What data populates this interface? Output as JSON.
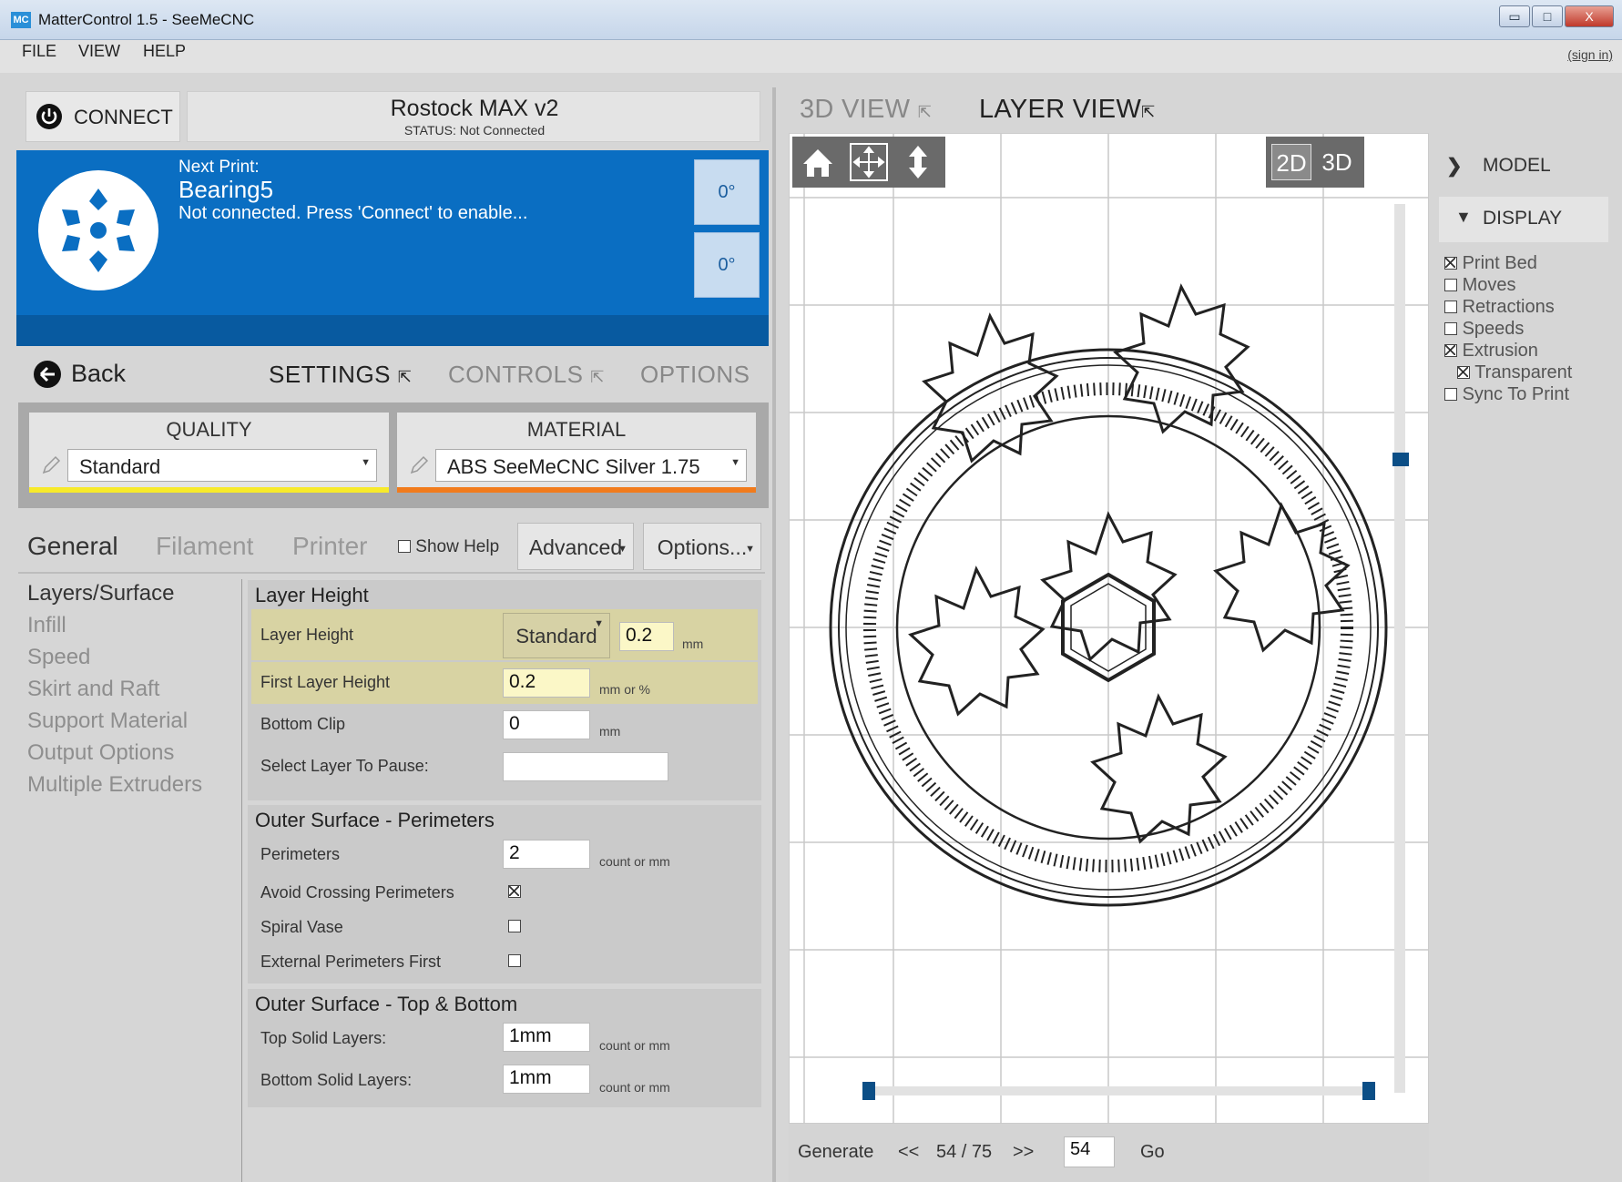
{
  "window": {
    "title": "MatterControl 1.5 - SeeMeCNC",
    "icon_label": "MC",
    "min": "▭",
    "max": "□",
    "close": "X"
  },
  "menu": {
    "items": [
      "FILE",
      "VIEW",
      "HELP"
    ],
    "sign_in": "(sign in)"
  },
  "printer": {
    "connect_label": "CONNECT",
    "name": "Rostock MAX v2",
    "status": "STATUS: Not Connected"
  },
  "print_panel": {
    "next_print_label": "Next Print:",
    "part_name": "Bearing5",
    "message": "Not connected. Press 'Connect' to enable...",
    "extruder_temp": "0°",
    "bed_temp": "0°"
  },
  "nav": {
    "back_label": "Back",
    "tabs": [
      {
        "label": "SETTINGS",
        "active": true
      },
      {
        "label": "CONTROLS",
        "active": false
      },
      {
        "label": "OPTIONS",
        "active": false
      }
    ]
  },
  "quality": {
    "title": "QUALITY",
    "value": "Standard",
    "color": "#f7ea2a"
  },
  "material": {
    "title": "MATERIAL",
    "value": "ABS SeeMeCNC Silver 1.75",
    "color": "#f17b1c"
  },
  "settings_tabs": {
    "tabs": [
      "General",
      "Filament",
      "Printer"
    ],
    "show_help": "Show Help",
    "advanced": "Advanced",
    "options": "Options..."
  },
  "categories": [
    "Layers/Surface",
    "Infill",
    "Speed",
    "Skirt and Raft",
    "Support Material",
    "Output Options",
    "Multiple Extruders"
  ],
  "groups": {
    "layer_height": {
      "title": "Layer Height",
      "layer_height": {
        "label": "Layer Height",
        "preset": "Standard",
        "value": "0.2",
        "unit": "mm"
      },
      "first_layer_height": {
        "label": "First Layer Height",
        "value": "0.2",
        "unit": "mm or %"
      },
      "bottom_clip": {
        "label": "Bottom Clip",
        "value": "0",
        "unit": "mm"
      },
      "pause_layer": {
        "label": "Select Layer To Pause:",
        "value": ""
      }
    },
    "perimeters": {
      "title": "Outer Surface - Perimeters",
      "perimeters": {
        "label": "Perimeters",
        "value": "2",
        "unit": "count or mm"
      },
      "avoid_crossing": {
        "label": "Avoid Crossing Perimeters",
        "checked": true
      },
      "spiral_vase": {
        "label": "Spiral Vase",
        "checked": false
      },
      "external_first": {
        "label": "External Perimeters First",
        "checked": false
      }
    },
    "top_bottom": {
      "title": "Outer Surface - Top & Bottom",
      "top_solid": {
        "label": "Top Solid Layers:",
        "value": "1mm",
        "unit": "count or mm"
      },
      "bottom_solid": {
        "label": "Bottom Solid Layers:",
        "value": "1mm",
        "unit": "count or mm"
      }
    }
  },
  "view_tabs": [
    {
      "label": "3D VIEW",
      "active": false
    },
    {
      "label": "LAYER VIEW",
      "active": true
    }
  ],
  "view_mode": {
    "d2": "2D",
    "d3": "3D"
  },
  "side_panel": {
    "model": "MODEL",
    "display": "DISPLAY",
    "options": [
      {
        "label": "Print Bed",
        "checked": true
      },
      {
        "label": "Moves",
        "checked": false
      },
      {
        "label": "Retractions",
        "checked": false
      },
      {
        "label": "Speeds",
        "checked": false
      },
      {
        "label": "Extrusion",
        "checked": true
      },
      {
        "label": "Transparent",
        "checked": true
      },
      {
        "label": "Sync To Print",
        "checked": false
      }
    ]
  },
  "layer_nav": {
    "generate": "Generate",
    "prev": "<<",
    "position": "54 / 75",
    "next": ">>",
    "layer_input": "54",
    "go": "Go"
  },
  "layer_slider_fraction": 0.72,
  "colors": {
    "accent_blue": "#0a6ec2",
    "scroll_thumb": "#0b4e86",
    "highlight_row": "#d8d3a3"
  }
}
